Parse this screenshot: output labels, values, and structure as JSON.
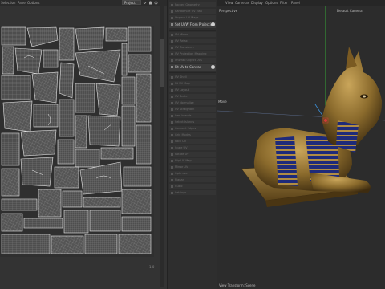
{
  "uv_editor": {
    "menu": [
      "Selection",
      "Panel",
      "Options"
    ],
    "project_select": "Project",
    "corner_label": "1.0"
  },
  "tools": {
    "items": [
      {
        "label": "Packed Geometry",
        "highlight": false
      },
      {
        "label": "Randomize UV Map",
        "highlight": false
      },
      {
        "label": "Unpack UV Maps",
        "highlight": false
      },
      {
        "label": "Set UVW From Projection",
        "highlight": true
      },
      {
        "label": "UV Mirror",
        "highlight": false
      },
      {
        "label": "UV Relax",
        "highlight": false
      },
      {
        "label": "UV Transform",
        "highlight": false
      },
      {
        "label": "UV Projection Mapping",
        "highlight": false
      },
      {
        "label": "Unwrap Object UVs",
        "highlight": false
      },
      {
        "label": "Fit UV to Canvas",
        "highlight": true
      },
      {
        "label": "UV Shell",
        "highlight": false
      },
      {
        "label": "Fit UV Map",
        "highlight": false
      },
      {
        "label": "UV Layout",
        "highlight": false
      },
      {
        "label": "UV Scale",
        "highlight": false
      },
      {
        "label": "UV Normalize",
        "highlight": false
      },
      {
        "label": "UV Straighten",
        "highlight": false
      },
      {
        "label": "Sew Islands",
        "highlight": false
      },
      {
        "label": "Select Islands",
        "highlight": false
      },
      {
        "label": "Connect Edges",
        "highlight": false
      },
      {
        "label": "Grid Modes",
        "highlight": false
      },
      {
        "label": "Pack UV",
        "highlight": false
      },
      {
        "label": "Scale UV",
        "highlight": false
      },
      {
        "label": "Rotate UV",
        "highlight": false
      },
      {
        "label": "Flip UV Map",
        "highlight": false
      },
      {
        "label": "Mirror UV",
        "highlight": false
      },
      {
        "label": "Optimize",
        "highlight": false
      },
      {
        "label": "Planar",
        "highlight": false
      },
      {
        "label": "Cubic",
        "highlight": false
      },
      {
        "label": "Settings",
        "highlight": false
      }
    ]
  },
  "viewport": {
    "menu": [
      "View",
      "Cameras",
      "Display",
      "Options",
      "Filter",
      "Panel"
    ],
    "projection": "Perspective",
    "camera": "Default Camera",
    "axis_label": "Move",
    "footer": "View Transform: Scene"
  },
  "colors": {
    "accent_blue": "#3a8fd8",
    "axis_red": "#d23a3a",
    "axis_green": "#3ac23a",
    "statue_gold": "#9b7a35",
    "stripe_blue": "#1e2a7a"
  }
}
